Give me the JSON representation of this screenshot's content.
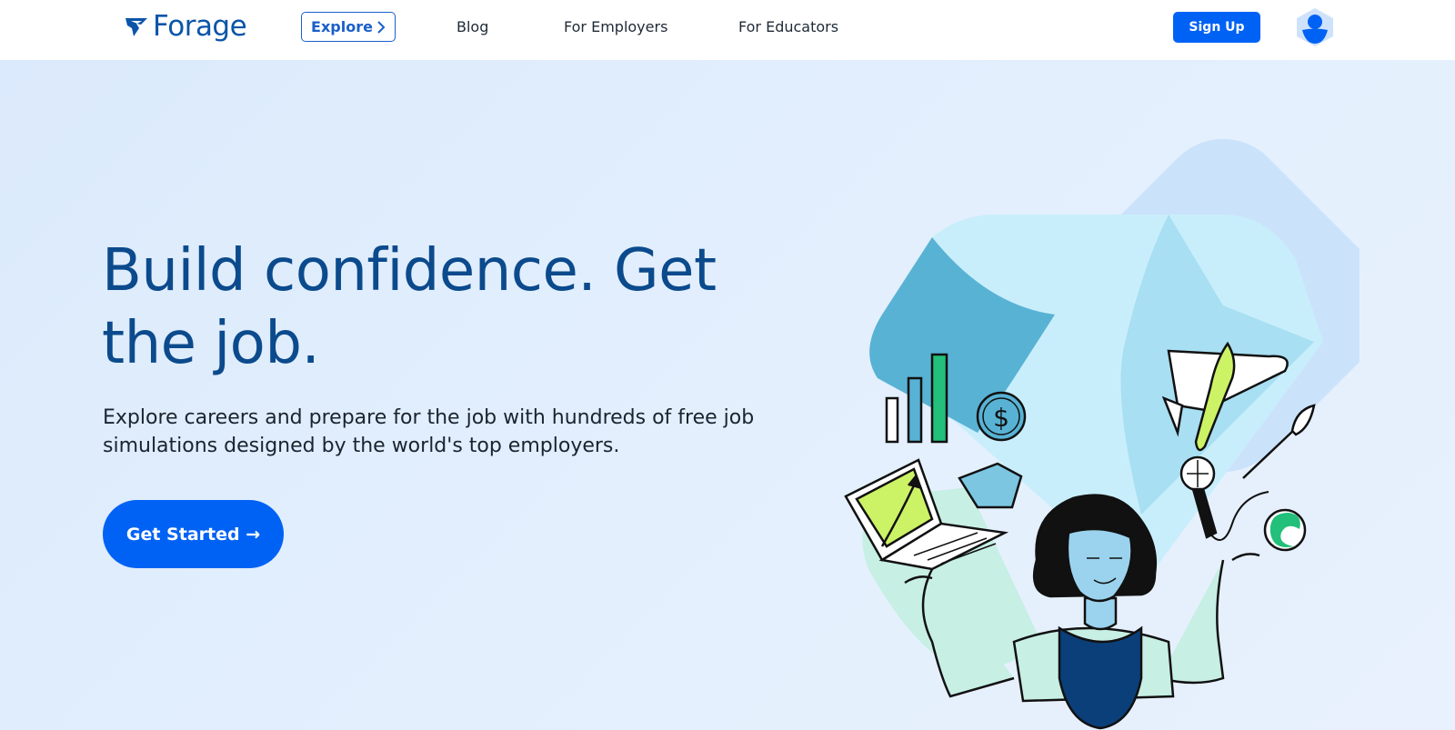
{
  "header": {
    "logo_text": "Forage",
    "logo_icon": "forage-logo-icon",
    "nav": {
      "explore_label": "Explore",
      "blog_label": "Blog",
      "employers_label": "For Employers",
      "educators_label": "For Educators"
    },
    "signup_label": "Sign Up",
    "avatar_icon": "user-icon"
  },
  "hero": {
    "headline": "Build confidence. Get the job.",
    "subtext": "Explore careers and prepare for the job with hundreds of free job simulations designed by the world's top employers.",
    "cta_label": "Get Started →",
    "illustration_icons": [
      "bar-chart-icon",
      "dollar-coin-icon",
      "laptop-icon",
      "document-icon",
      "airplane-icon",
      "paintbrush-icon",
      "microphone-icon",
      "paint-swatch-icon",
      "person-illustration"
    ]
  },
  "colors": {
    "brand_blue": "#0062f5",
    "headline_blue": "#0b4a8c",
    "hero_background": "#e3effd"
  }
}
